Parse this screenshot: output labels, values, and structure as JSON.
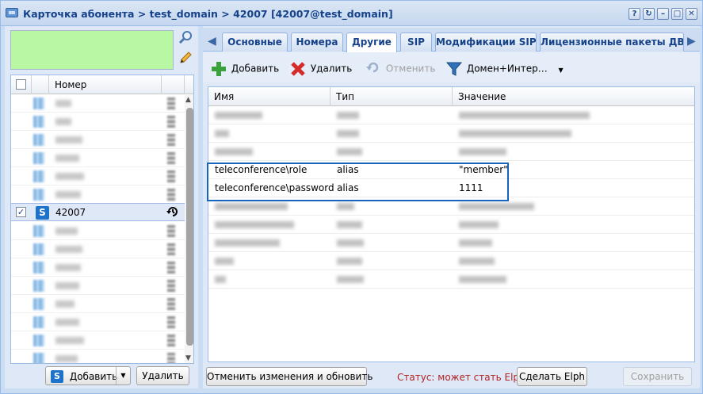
{
  "window": {
    "title": "Карточка абонента > test_domain > 42007 [42007@test_domain]"
  },
  "title_buttons": [
    "?",
    "↻",
    "–",
    "□",
    "✕"
  ],
  "left": {
    "search_icon": "search-icon",
    "edit_icon": "pencil-icon",
    "column_header": "Номер",
    "selected_row": {
      "number": "42007",
      "badge": "S"
    },
    "add_button": "Добавить",
    "delete_button": "Удалить"
  },
  "tabs": [
    {
      "label": "Основные",
      "active": false
    },
    {
      "label": "Номера",
      "active": false
    },
    {
      "label": "Другие",
      "active": true
    },
    {
      "label": "SIP",
      "active": false
    },
    {
      "label": "Модификации SIP",
      "active": false
    },
    {
      "label": "Лицензионные пакеты ДВО",
      "active": false
    }
  ],
  "toolbar": {
    "add": "Добавить",
    "delete": "Удалить",
    "cancel": "Отменить",
    "filter": "Домен+Интер…"
  },
  "grid": {
    "columns": [
      "Имя",
      "Тип",
      "Значение"
    ],
    "visible_rows": [
      {
        "name": "teleconference\\role",
        "type": "alias",
        "value": "\"member\""
      },
      {
        "name": "teleconference\\password",
        "type": "alias",
        "value": "1111"
      }
    ]
  },
  "footer": {
    "refresh_button": "Отменить изменения и обновить",
    "status": "Статус: может стать Elph",
    "make_elph_button": "Сделать Elph",
    "save_button": "Сохранить"
  },
  "colors": {
    "accent": "#15428b",
    "filter_box": "#b9f7a3",
    "highlight": "#1565c0",
    "status": "#b22222"
  }
}
